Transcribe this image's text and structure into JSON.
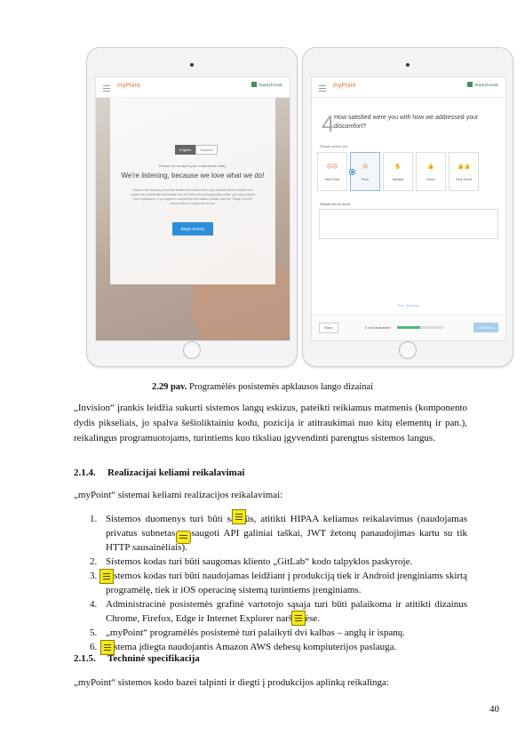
{
  "left_tablet": {
    "app_name": "myPoint",
    "brand": "Sunnybrook",
    "lang_english": "English",
    "lang_spanish": "Español",
    "tell_us": "Please tell us about your experience today.",
    "headline": "We're listening, because we love what we do!",
    "fine_print": "Please note that any protected health information which you submit will be retained and treated as confidential information, as set forth in the privacy policy which you may request from registration. If you agree to submit this information please click the \"Begin Survey\" below button to begin the survey.",
    "begin_button": "Begin Survey"
  },
  "right_tablet": {
    "app_name": "myPoint",
    "brand": "Sunnybrook",
    "question_number": "4",
    "question": "How satisfied were you with how we addressed your discomfort?",
    "select_one": "Please select one",
    "options": [
      {
        "label": "Very Poor",
        "icon": "very-poor-icon",
        "glyph": "☹☹"
      },
      {
        "label": "Poor",
        "icon": "poor-icon",
        "glyph": "☹"
      },
      {
        "label": "Neutral",
        "icon": "neutral-icon",
        "glyph": "✋"
      },
      {
        "label": "Good",
        "icon": "good-icon",
        "glyph": "👍"
      },
      {
        "label": "Very Good",
        "icon": "very-good-icon",
        "glyph": "👍👍"
      }
    ],
    "selected_option": "Poor",
    "tell_more": "Please tell us more",
    "skip": "Skip Question",
    "back_button": "Back",
    "progress_text": "3 of 6 answered",
    "progress_fraction": 0.5,
    "continue_button": "Continue"
  },
  "caption": {
    "number": "2.29 pav.",
    "text": " Programėlės posistemės apklausos lango dizainai"
  },
  "para_invision": "„Invision“ įrankis leidžia sukurti sistemos langų eskizus, pateikti reikiamus matmenis (komponento dydis pikseliais, jo spalva šešioliktainiu kodu, pozicija ir atitraukimai nuo kitų elementų ir pan.), reikalingus programuotojams, turintiems kuo tiksliau įgyvendinti parengtus sistemos langus.",
  "section_214": {
    "number": "2.1.4.",
    "title": "Realizacijai keliami reikalavimai"
  },
  "para_requirements": "„myPoint“ sistemai keliami realizacijos reikalavimai:",
  "requirements": [
    {
      "n": "1.",
      "html": "Sistemos duomenys turi būti saugūs, atitikti HIPAA keliamus reikalavimus (naudojamas privatus subnetas, apsaugoti API galiniai taškai, JWT žetonų panaudojimas kartu su tik HTTP sausainėliais)."
    },
    {
      "n": "2.",
      "html": "Sistemos kodas turi būti saugomas kliento „GitLab“ kodo talpyklos paskyroje."
    },
    {
      "n": "3.",
      "html": "Sistemos kodas turi būti naudojamas leidžiant į produkciją tiek ir Android įrenginiams skirtą programėlę, tiek ir iOS operacinę sistemą turintiems įrenginiams."
    },
    {
      "n": "4.",
      "html": "Administracinė posistemės grafinė vartotojo sąsaja turi būti palaikoma ir atitikti dizainus Chrome, Firefox, Edge ir Internet Explorer naršyklėse."
    },
    {
      "n": "5.",
      "html": "„myPoint“ programėlės posistemė turi palaikyti dvi kalbas – anglų ir ispanų."
    },
    {
      "n": "6.",
      "html": "Sistema įdiegta naudojantis Amazon AWS debesų kompiuterijos paslauga."
    }
  ],
  "section_215": {
    "number": "2.1.5.",
    "title": "Techninė specifikacija"
  },
  "para_deploy": "„myPoint“ sistemos kodo bazei talpinti ir diegti į produkcijos aplinką reikalinga:",
  "page_number": "40",
  "colors": {
    "accent_orange": "#e2742a",
    "brand_green": "#2e6b48",
    "button_blue": "#2f8ed8",
    "progress_green": "#4dbb7a",
    "note_yellow": "#f6e71b"
  }
}
